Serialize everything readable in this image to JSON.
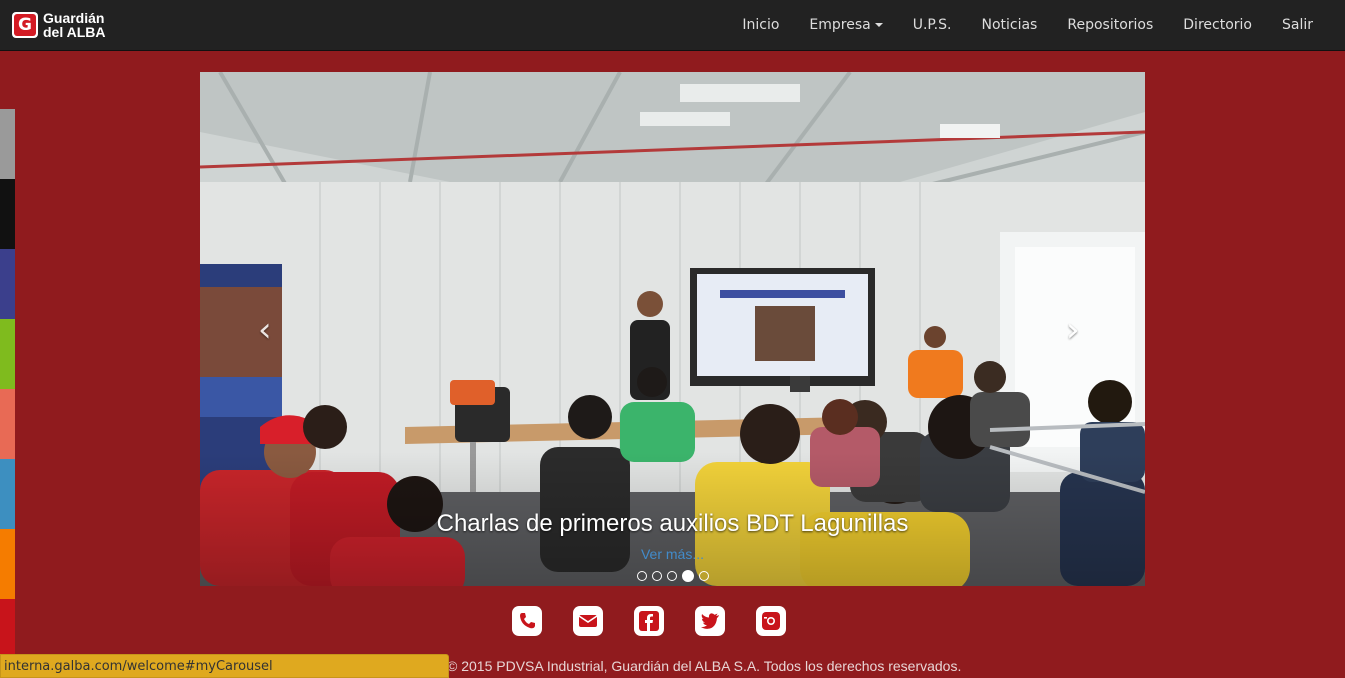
{
  "brand": {
    "line1": "Guardián",
    "line2": "del ALBA",
    "icon": "guardian-g-logo"
  },
  "nav": {
    "items": [
      {
        "label": "Inicio"
      },
      {
        "label": "Empresa",
        "dropdown": true
      },
      {
        "label": "U.P.S."
      },
      {
        "label": "Noticias"
      },
      {
        "label": "Repositorios"
      },
      {
        "label": "Directorio"
      },
      {
        "label": "Salir"
      }
    ]
  },
  "side_strip_colors": [
    "#9a9a9a",
    "#111111",
    "#3b3f8c",
    "#7fbb1e",
    "#e86a55",
    "#3d8fc0",
    "#f57c00",
    "#c8141b"
  ],
  "carousel": {
    "caption": "Charlas de primeros auxilios BDT Lagunillas",
    "more_link": "Ver más...",
    "slide_count": 5,
    "active_index": 3,
    "prev_icon": "chevron-left-icon",
    "next_icon": "chevron-right-icon"
  },
  "social": [
    "phone-icon",
    "mail-icon",
    "facebook-icon",
    "twitter-icon",
    "instagram-icon"
  ],
  "footer": {
    "text": "© 2015 PDVSA Industrial, Guardián del ALBA S.A. Todos los derechos reservados."
  },
  "status_bar": {
    "url": "interna.galba.com/welcome#myCarousel"
  },
  "colors": {
    "page_bg": "#901b1e",
    "navbar_bg": "#222222",
    "status_bar_bg": "#dfa91f"
  }
}
